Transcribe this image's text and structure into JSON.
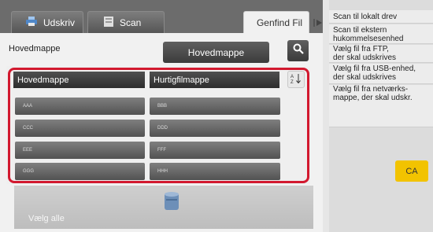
{
  "tabs": [
    {
      "label": "Udskriv",
      "icon": "print-icon"
    },
    {
      "label": "Scan",
      "icon": "scan-icon"
    },
    {
      "label": "Genfind Fil"
    }
  ],
  "folder": {
    "label": "Hovedmappe",
    "selected": "Hovedmappe",
    "search_icon": "search-icon"
  },
  "table": {
    "headers": [
      "Hovedmappe",
      "Hurtigfilmappe"
    ],
    "sort_icon": "sort-az-icon",
    "rows": [
      [
        "AAA",
        "BBB"
      ],
      [
        "CCC",
        "DDD"
      ],
      [
        "EEE",
        "FFF"
      ],
      [
        "GGG",
        "HHH"
      ]
    ]
  },
  "bottom": {
    "select_all": "Vælg alle",
    "storage_icon": "storage-icon"
  },
  "sidebar": {
    "collapse_icon": "collapse-arrow-icon",
    "items": [
      {
        "line1": "Scan til lokalt drev",
        "line2": ""
      },
      {
        "line1": "Scan til ekstern",
        "line2": "hukommelsesenhed"
      },
      {
        "line1": "Vælg fil fra FTP,",
        "line2": "der skal udskrives"
      },
      {
        "line1": "Vælg fil fra USB-enhed,",
        "line2": "der skal udskrives"
      },
      {
        "line1": "Vælg fil fra netværks-",
        "line2": "mappe, der skal udskr."
      }
    ],
    "ca_label": "CA"
  },
  "colors": {
    "highlight": "#d2192f",
    "ca_button": "#f2c300"
  }
}
